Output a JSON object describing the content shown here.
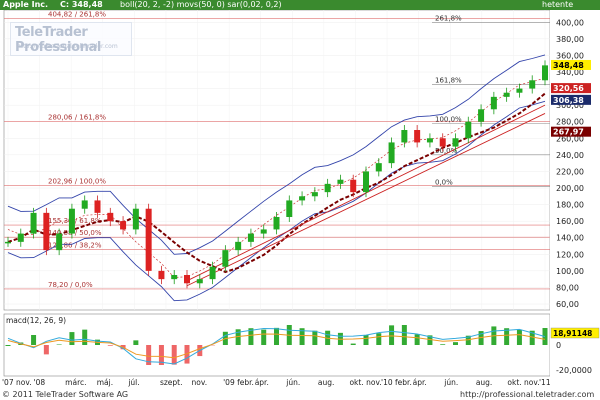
{
  "header": {
    "symbol": "Apple Inc.",
    "last_price": "C: 348,48",
    "indicators": "boll(20, 2, -2) movs(50, 0) sar(0,02, 0,2)",
    "interval": "hetente"
  },
  "watermark": {
    "brand": "TeleTrader Professional",
    "url": "http://professional.teletrader.com"
  },
  "fib_levels": [
    {
      "label": "404,82 / 261,8%",
      "value": 404.82
    },
    {
      "label": "280,06 / 161,8%",
      "value": 280.06
    },
    {
      "label": "202,96 / 100,0%",
      "value": 202.96
    },
    {
      "label": "155,30 / 61,8%",
      "value": 155.3
    },
    {
      "label": "140,58 / 50,0%",
      "value": 140.58
    },
    {
      "label": "125,86 / 38,2%",
      "value": 125.86
    },
    {
      "label": "78,20 / 0,0%",
      "value": 78.2
    }
  ],
  "fib_levels_recent": [
    {
      "label": "261,8%",
      "value": 400
    },
    {
      "label": "161,8%",
      "value": 325
    },
    {
      "label": "100,0%",
      "value": 278
    },
    {
      "label": "50,0%",
      "value": 240
    },
    {
      "label": "0,0%",
      "value": 202
    }
  ],
  "price_badges": [
    {
      "text": "348,48",
      "value": 348.48,
      "color": "#ffee00",
      "fg": "#000000"
    },
    {
      "text": "320,56",
      "value": 320.56,
      "color": "#cc2222",
      "fg": "#ffffff"
    },
    {
      "text": "306,38",
      "value": 306.38,
      "color": "#1a2a6a",
      "fg": "#ffffff"
    },
    {
      "text": "267,97",
      "value": 267.97,
      "color": "#7a0000",
      "fg": "#ffffff"
    }
  ],
  "macd": {
    "label": "macd(12, 26, 9)",
    "value_badge": "18,91148",
    "axis_ticks": [
      "0",
      "-20,0000"
    ]
  },
  "footer": {
    "copyright": "© 2011 TeleTrader Software AG",
    "url": "http://professional.teletrader.com"
  },
  "chart_data": {
    "type": "candlestick",
    "title": "Apple Inc.",
    "yaxis_ticks": [
      "400,00",
      "380,00",
      "360,00",
      "340,00",
      "320,00",
      "300,00",
      "280,00",
      "260,00",
      "240,00",
      "220,00",
      "200,00",
      "180,00",
      "160,00",
      "140,00",
      "120,00",
      "100,00",
      "80,00",
      "60,00"
    ],
    "ylim": [
      60,
      410
    ],
    "xaxis_ticks": [
      "'07 nov.",
      "'08",
      "márc.",
      "máj.",
      "júl.",
      "szept.",
      "nov.",
      "'09 febr.",
      "ápr.",
      "jún.",
      "aug.",
      "okt. nov.",
      "'10 febr.",
      "ápr.",
      "jún.",
      "aug.",
      "okt. nov.",
      "'11"
    ],
    "series": [
      {
        "name": "price",
        "x": [
          0,
          4,
          8,
          12,
          16,
          20,
          24,
          28,
          32,
          36,
          40,
          44,
          48,
          52,
          56,
          60,
          64,
          68,
          72,
          76,
          80,
          84,
          88,
          92,
          96,
          100,
          104,
          108,
          112,
          116,
          120,
          124,
          128,
          132,
          136,
          140,
          144,
          148,
          152,
          156,
          160,
          164,
          168
        ],
        "values": [
          135,
          145,
          170,
          125,
          145,
          175,
          185,
          170,
          160,
          150,
          175,
          100,
          90,
          95,
          85,
          90,
          105,
          125,
          135,
          145,
          150,
          165,
          185,
          190,
          195,
          205,
          210,
          195,
          220,
          230,
          255,
          270,
          255,
          260,
          250,
          260,
          280,
          295,
          310,
          315,
          320,
          330,
          348
        ]
      }
    ]
  }
}
